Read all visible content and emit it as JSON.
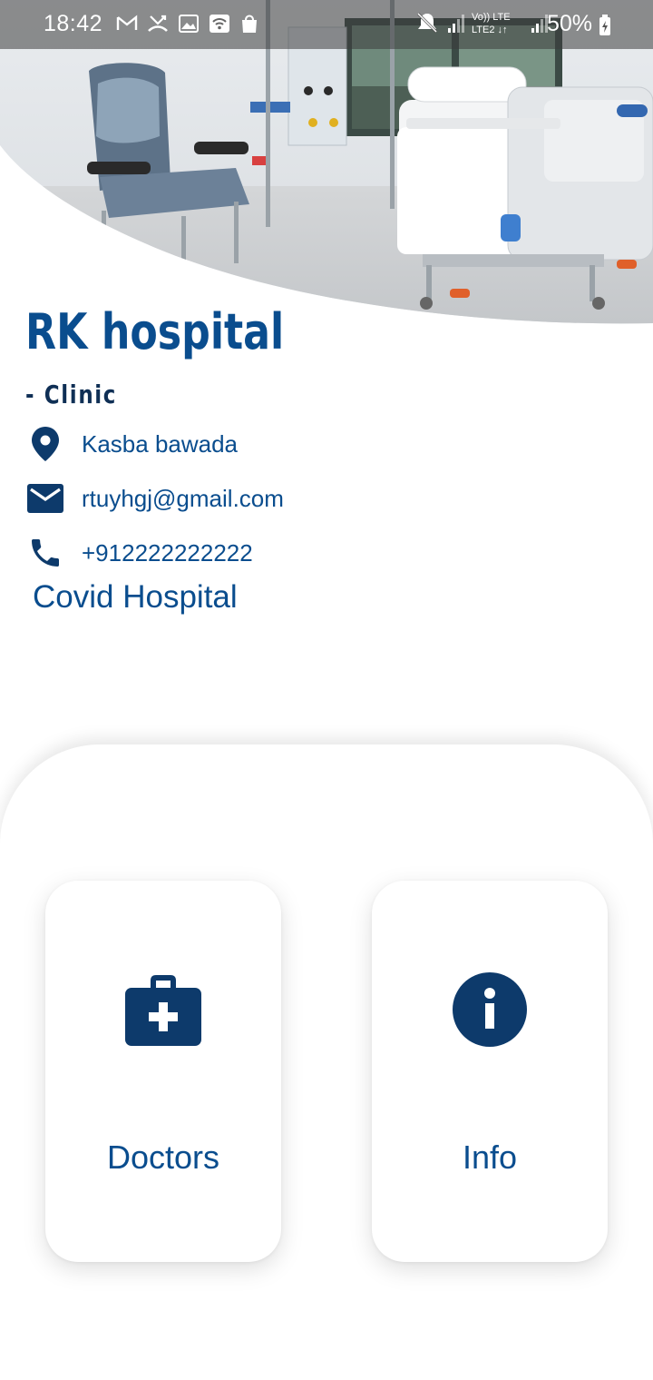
{
  "status_bar": {
    "time": "18:42",
    "battery": "50%",
    "network_label": "LTE",
    "left_icons": [
      "gmail-icon",
      "missed-call-icon",
      "gallery-icon",
      "wifi-icon",
      "shopping-bag-icon"
    ],
    "right_icons": [
      "mute-icon",
      "signal-icon",
      "volte-icon",
      "signal-icon",
      "battery-charging-icon"
    ]
  },
  "hero": {
    "image_name": "hospital-room-photo"
  },
  "hospital": {
    "name": "RK hospital",
    "type": "- Clinic",
    "address": "Kasba bawada",
    "email": "rtuyhgj@gmail.com",
    "phone": "+912222222222",
    "category": "Covid Hospital"
  },
  "cards": {
    "doctors": {
      "label": "Doctors",
      "icon": "medical-bag-icon"
    },
    "info": {
      "label": "Info",
      "icon": "info-icon"
    }
  },
  "colors": {
    "primary": "#0a4d8e",
    "icon_dark": "#0d3a6b",
    "title_dark": "#0f2f55",
    "background": "#ffffff"
  }
}
